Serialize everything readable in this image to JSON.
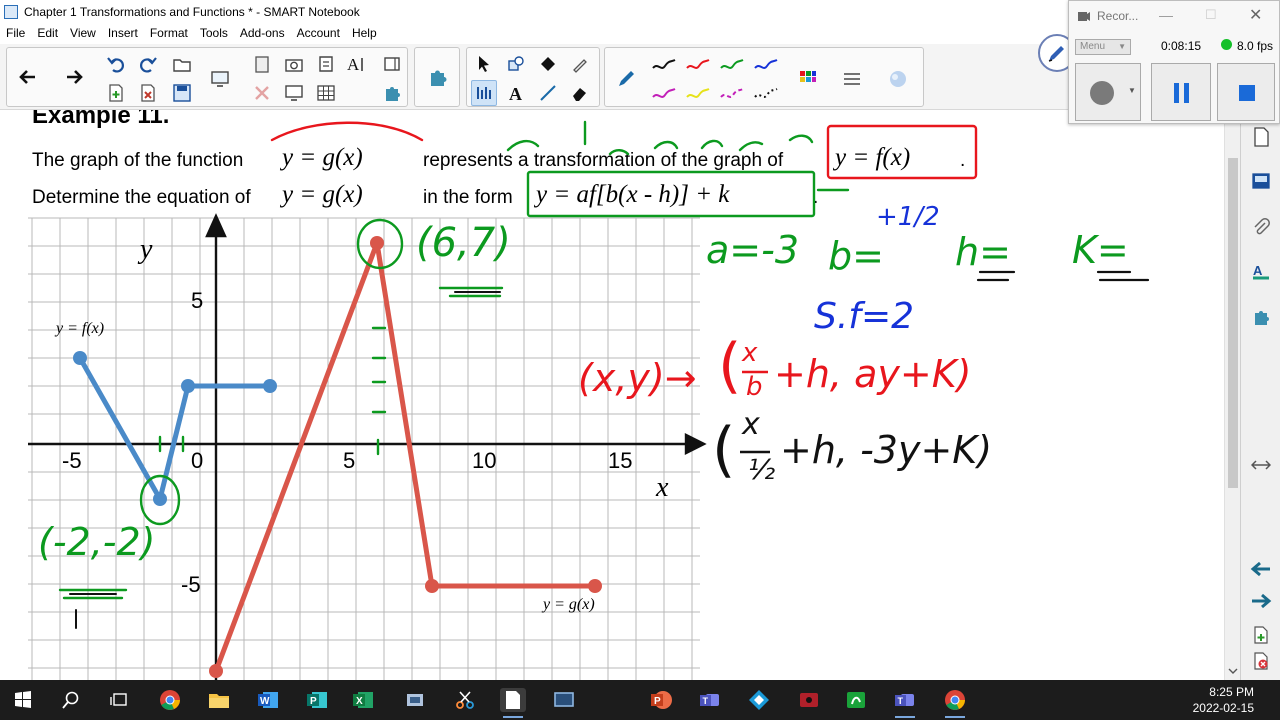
{
  "window": {
    "title": "Chapter 1 Transformations and Functions * - SMART Notebook"
  },
  "menu": [
    "File",
    "Edit",
    "View",
    "Insert",
    "Format",
    "Tools",
    "Add-ons",
    "Account",
    "Help"
  ],
  "recorder": {
    "title": "Recor...",
    "menu_label": "Menu",
    "elapsed": "0:08:15",
    "fps": "8.0 fps"
  },
  "slide": {
    "heading": "Example 11.",
    "line1_prefix": "The graph of the function",
    "line1_middle": "represents a transformation of the graph of",
    "line1_end": ".",
    "line2_prefix": "Determine the equation of",
    "line2_middle": "in the form",
    "line2_end": ".",
    "eq_g": "y = g(x)",
    "eq_f": "y = f(x)",
    "eq_form": "y = af[b(x - h)] + k",
    "axis_x": "x",
    "axis_y": "y",
    "label_f": "y = f(x)",
    "label_g": "y = g(x)",
    "x_ticks": [
      "-5",
      "0",
      "5",
      "10",
      "15"
    ],
    "y_ticks": [
      "5",
      "-5"
    ]
  },
  "handwriting": {
    "point_max": "(6,7)",
    "point_min": "(-2,-2)",
    "a": "a=-3",
    "b": "b=",
    "b_value": "+1/2",
    "h": "h=",
    "k": "K=",
    "sf": "S.f=2",
    "mapping_left": "(x,y)→",
    "mapping_x_num": "x",
    "mapping_x_den": "b",
    "mapping_rest": "+h, ay+K)",
    "mapping2_x_num": "x",
    "mapping2_x_den": "½",
    "mapping2_rest": "+h, -3y+K)"
  },
  "taskbar": {
    "time": "8:25 PM",
    "date": "2022-02-15"
  },
  "colors": {
    "f_graph": "#4a8ac8",
    "g_graph": "#d9564a",
    "ink_red": "#e8161d",
    "ink_green": "#0c9a1f",
    "ink_blue": "#1632d8",
    "ink_black": "#111111"
  }
}
